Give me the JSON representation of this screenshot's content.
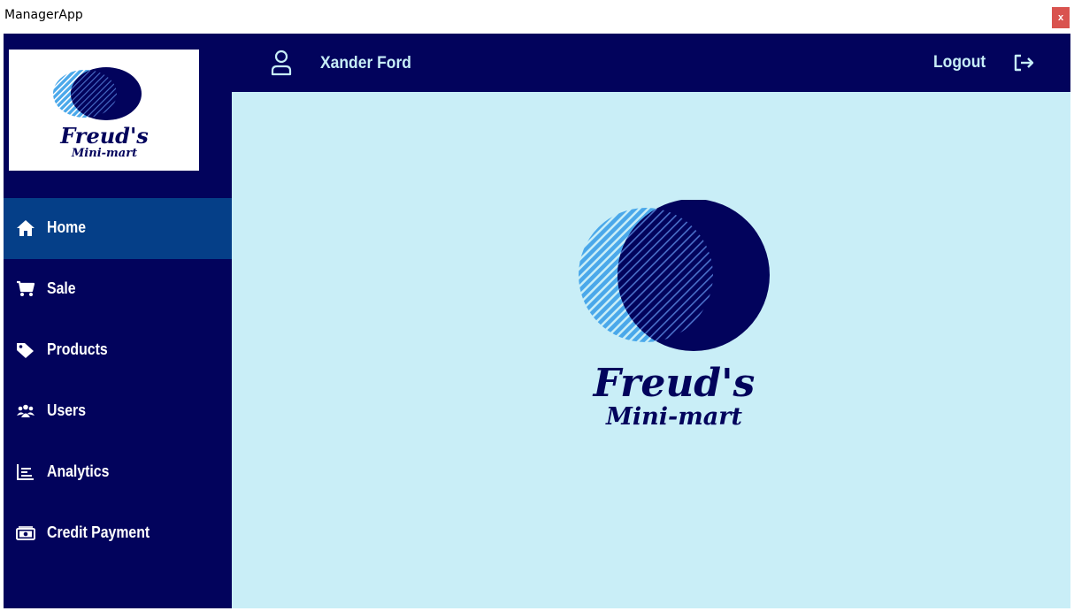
{
  "window": {
    "title": "ManagerApp",
    "close_label": "x"
  },
  "brand": {
    "line1": "Freud's",
    "line2": "Mini-mart",
    "colors": {
      "navy": "#02035c",
      "light_blue": "#4aa8ea",
      "content_bg": "#c9eef7",
      "active_nav": "#053f88"
    }
  },
  "sidebar": {
    "items": [
      {
        "label": "Home",
        "icon": "home-icon",
        "active": true
      },
      {
        "label": "Sale",
        "icon": "cart-icon",
        "active": false
      },
      {
        "label": "Products",
        "icon": "tag-icon",
        "active": false
      },
      {
        "label": "Users",
        "icon": "users-icon",
        "active": false
      },
      {
        "label": "Analytics",
        "icon": "analytics-icon",
        "active": false
      },
      {
        "label": "Credit Payment",
        "icon": "cash-icon",
        "active": false
      }
    ]
  },
  "header": {
    "user_name": "Xander Ford",
    "user_icon": "user-icon",
    "logout_label": "Logout",
    "logout_icon": "logout-icon"
  }
}
